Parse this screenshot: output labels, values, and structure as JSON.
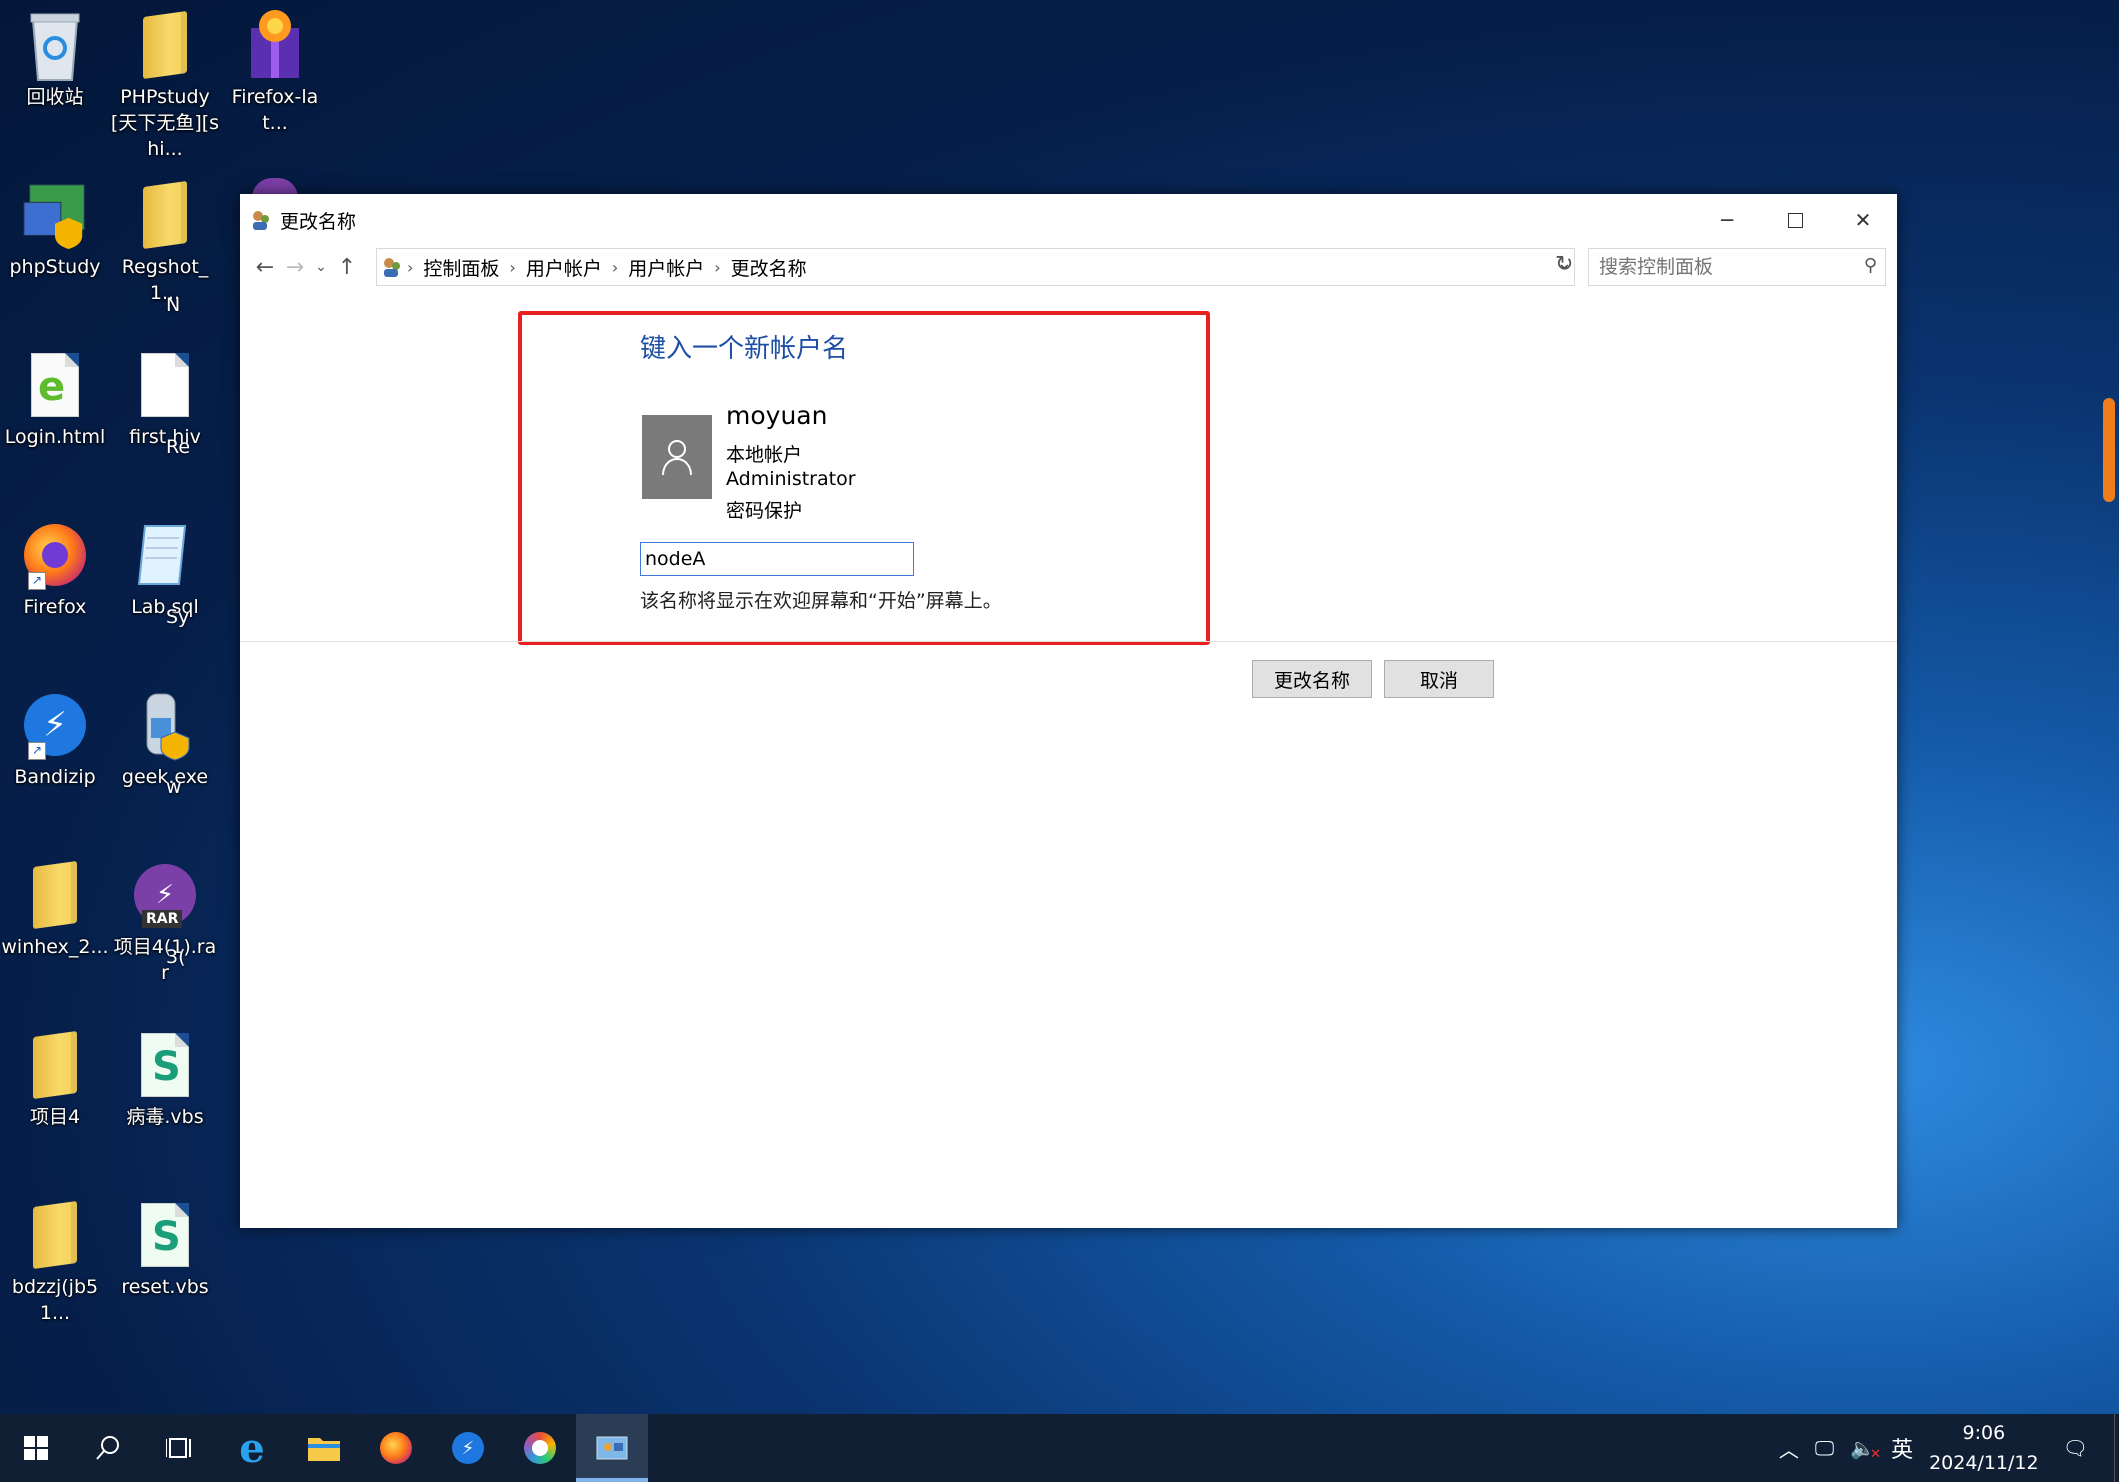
{
  "desktop": {
    "icons": [
      {
        "label": "回收站",
        "icon": "recycle-bin-icon"
      },
      {
        "label": "PHPstudy[天下无鱼][shi...",
        "icon": "folder-icon"
      },
      {
        "label": "Firefox-lat...",
        "icon": "firefox-installer-icon"
      },
      {
        "label": "phpStudy",
        "icon": "phpstudy-icon"
      },
      {
        "label": "Regshot_1...",
        "icon": "folder-icon"
      },
      {
        "label": "Login.html",
        "icon": "html-file-icon"
      },
      {
        "label": "first.hiv",
        "icon": "file-icon"
      },
      {
        "label": "Firefox",
        "icon": "firefox-icon"
      },
      {
        "label": "Lab.sql",
        "icon": "sql-file-icon"
      },
      {
        "label": "Bandizip",
        "icon": "bandizip-icon"
      },
      {
        "label": "geek.exe",
        "icon": "exe-icon"
      },
      {
        "label": "winhex_2...",
        "icon": "folder-icon"
      },
      {
        "label": "项目4(1).rar",
        "icon": "rar-icon"
      },
      {
        "label": "项目4",
        "icon": "folder-icon"
      },
      {
        "label": "病毒.vbs",
        "icon": "vbs-script-icon"
      },
      {
        "label": "bdzzj(jb51...",
        "icon": "folder-icon"
      },
      {
        "label": "reset.vbs",
        "icon": "vbs-script-icon"
      }
    ],
    "partial_labels": [
      "N",
      "Re",
      "Sy",
      "w",
      "3("
    ],
    "rar_badge": "RAR"
  },
  "window": {
    "title": "更改名称",
    "breadcrumb": [
      "控制面板",
      "用户帐户",
      "用户帐户",
      "更改名称"
    ],
    "search_placeholder": "搜索控制面板",
    "heading": "键入一个新帐户名",
    "user": {
      "name": "moyuan",
      "type": "本地帐户",
      "role": "Administrator",
      "protection": "密码保护"
    },
    "new_name_value": "nodeA",
    "hint": "该名称将显示在欢迎屏幕和“开始”屏幕上。",
    "buttons": {
      "rename": "更改名称",
      "cancel": "取消"
    }
  },
  "taskbar": {
    "ime": "英",
    "time": "9:06",
    "date": "2024/11/12"
  },
  "colors": {
    "accent": "#1e4fa5",
    "highlight_box": "#e8201f",
    "taskbar": "#101f33"
  }
}
